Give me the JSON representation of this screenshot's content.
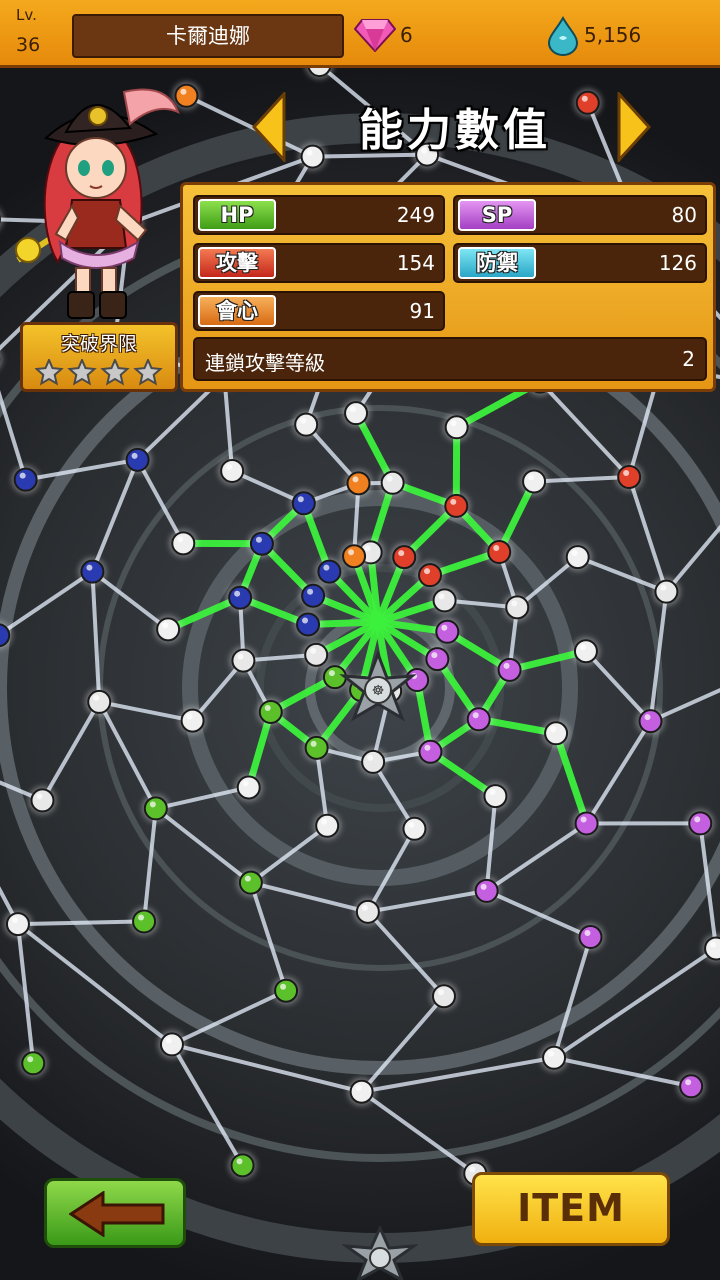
{
  "header": {
    "level_label": "Lv.",
    "level_value": "36",
    "character_name": "卡爾迪娜",
    "gem_count": "6",
    "mana_count": "5,156"
  },
  "page": {
    "title": "能力數值"
  },
  "character": {
    "limit_break_label": "突破界限",
    "limit_break_stars_total": 4,
    "limit_break_stars_filled": 0
  },
  "stats": {
    "hp_label": "HP",
    "hp_value": "249",
    "sp_label": "SP",
    "sp_value": "80",
    "atk_label": "攻擊",
    "atk_value": "154",
    "def_label": "防禦",
    "def_value": "126",
    "crit_label": "會心",
    "crit_value": "91",
    "chain_label": "連鎖攻擊等級",
    "chain_value": "2"
  },
  "buttons": {
    "item_label": "ITEM"
  },
  "colors": {
    "hp": "#5cc02a",
    "sp": "#c460e0",
    "atk": "#e0402a",
    "def": "#40c0e0",
    "crit": "#f08020",
    "active_link": "#3cf03c",
    "inactive_link": "#e8f2ff"
  }
}
